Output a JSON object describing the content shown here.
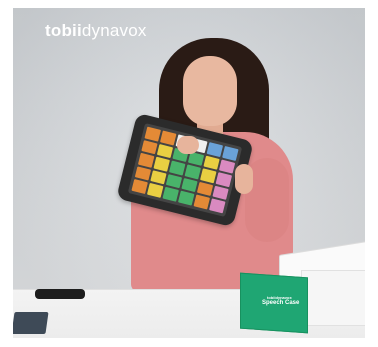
{
  "logo": {
    "brand_part1": "tobii",
    "brand_part2": "dynavox"
  },
  "product_box": {
    "small_label": "tobiidynavox",
    "label": "Speech Case"
  },
  "colors": {
    "box_green": "#1fa673",
    "sweater": "#e08a8b",
    "background": "#d9dcdf"
  }
}
